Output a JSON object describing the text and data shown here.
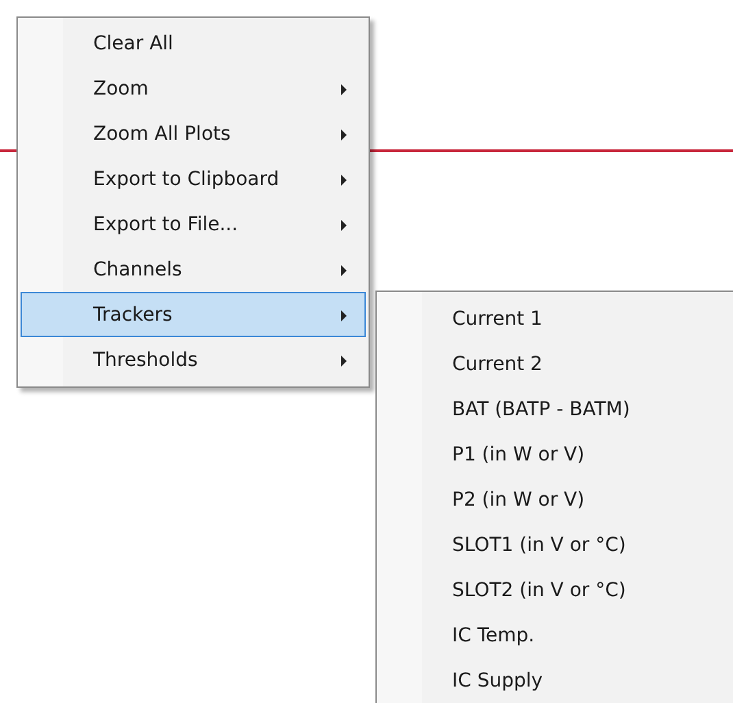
{
  "context_menu": {
    "items": [
      {
        "label": "Clear All",
        "has_submenu": false,
        "selected": false
      },
      {
        "label": "Zoom",
        "has_submenu": true,
        "selected": false
      },
      {
        "label": "Zoom All Plots",
        "has_submenu": true,
        "selected": false
      },
      {
        "label": "Export to Clipboard",
        "has_submenu": true,
        "selected": false
      },
      {
        "label": "Export to File...",
        "has_submenu": true,
        "selected": false
      },
      {
        "label": "Channels",
        "has_submenu": true,
        "selected": false
      },
      {
        "label": "Trackers",
        "has_submenu": true,
        "selected": true
      },
      {
        "label": "Thresholds",
        "has_submenu": true,
        "selected": false
      }
    ]
  },
  "submenu": {
    "items": [
      {
        "label": "Current 1"
      },
      {
        "label": "Current 2"
      },
      {
        "label": "BAT (BATP - BATM)"
      },
      {
        "label": "P1 (in W or V)"
      },
      {
        "label": "P2 (in W or V)"
      },
      {
        "label": "SLOT1 (in V or °C)"
      },
      {
        "label": "SLOT2 (in V or °C)"
      },
      {
        "label": "IC Temp."
      },
      {
        "label": "IC Supply"
      }
    ]
  }
}
